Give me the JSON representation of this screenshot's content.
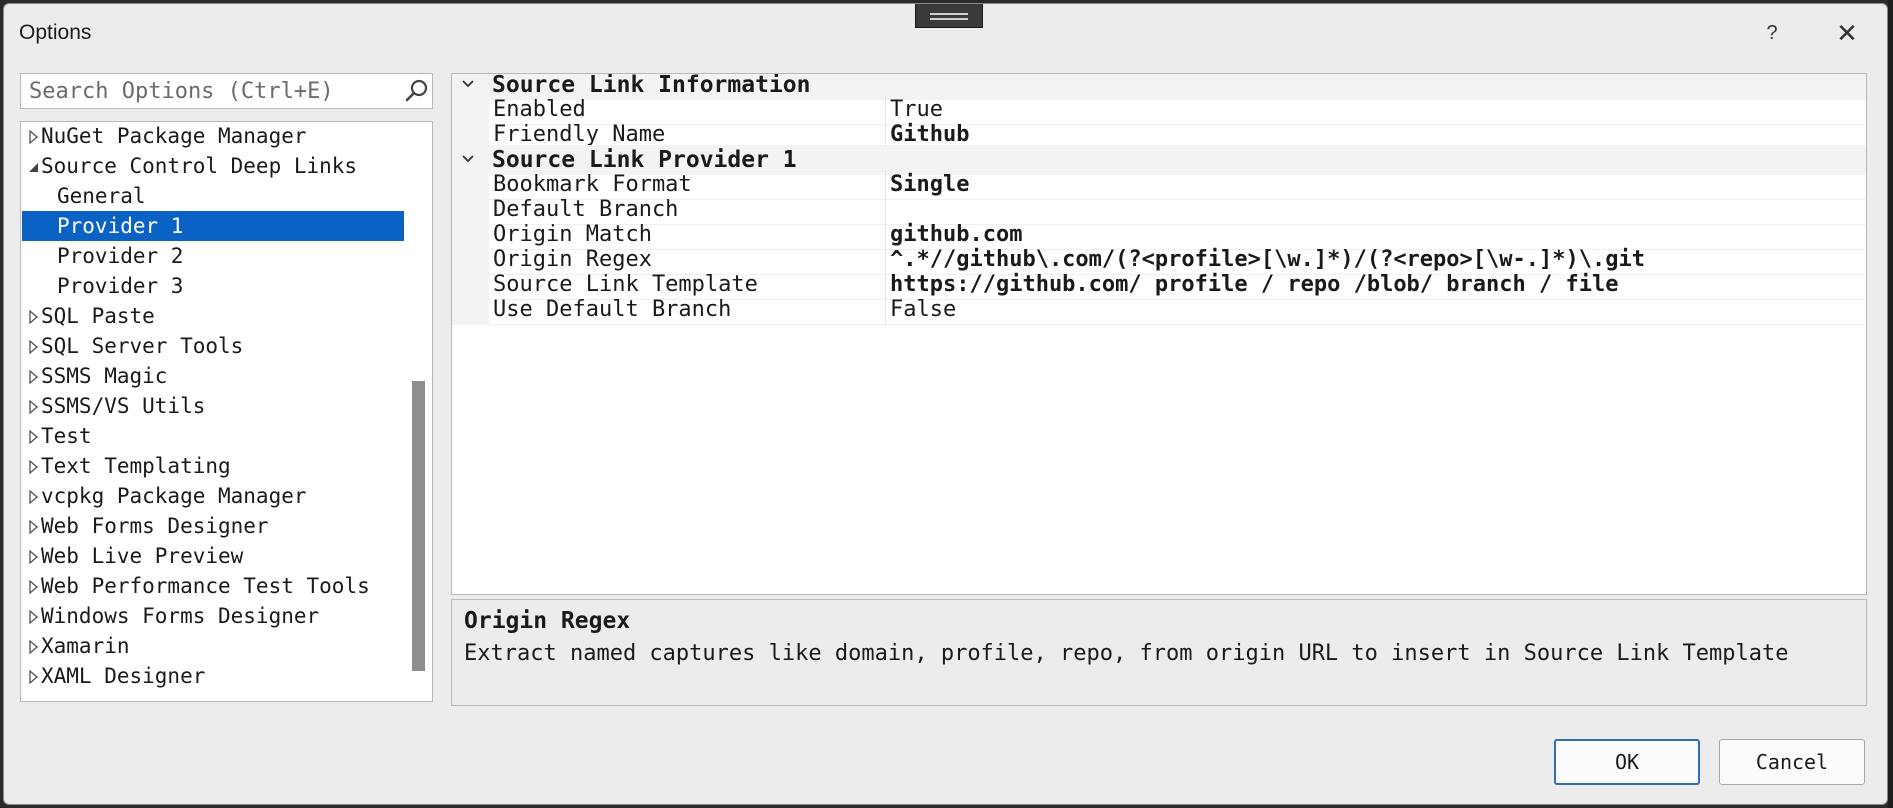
{
  "window": {
    "title": "Options",
    "help_glyph": "?",
    "close_glyph": "✕"
  },
  "search": {
    "placeholder": "Search Options (Ctrl+E)",
    "value": ""
  },
  "tree": {
    "items": [
      {
        "label": "NuGet Package Manager",
        "level": 0,
        "expander": "collapsed",
        "selected": false
      },
      {
        "label": "Source Control Deep Links",
        "level": 0,
        "expander": "expanded",
        "selected": false
      },
      {
        "label": "General",
        "level": 1,
        "expander": "none",
        "selected": false
      },
      {
        "label": "Provider 1",
        "level": 1,
        "expander": "none",
        "selected": true
      },
      {
        "label": "Provider 2",
        "level": 1,
        "expander": "none",
        "selected": false
      },
      {
        "label": "Provider 3",
        "level": 1,
        "expander": "none",
        "selected": false
      },
      {
        "label": "SQL Paste",
        "level": 0,
        "expander": "collapsed",
        "selected": false
      },
      {
        "label": "SQL Server Tools",
        "level": 0,
        "expander": "collapsed",
        "selected": false
      },
      {
        "label": "SSMS Magic",
        "level": 0,
        "expander": "collapsed",
        "selected": false
      },
      {
        "label": "SSMS/VS Utils",
        "level": 0,
        "expander": "collapsed",
        "selected": false
      },
      {
        "label": "Test",
        "level": 0,
        "expander": "collapsed",
        "selected": false
      },
      {
        "label": "Text Templating",
        "level": 0,
        "expander": "collapsed",
        "selected": false
      },
      {
        "label": "vcpkg Package Manager",
        "level": 0,
        "expander": "collapsed",
        "selected": false
      },
      {
        "label": "Web Forms Designer",
        "level": 0,
        "expander": "collapsed",
        "selected": false
      },
      {
        "label": "Web Live Preview",
        "level": 0,
        "expander": "collapsed",
        "selected": false
      },
      {
        "label": "Web Performance Test Tools",
        "level": 0,
        "expander": "collapsed",
        "selected": false
      },
      {
        "label": "Windows Forms Designer",
        "level": 0,
        "expander": "collapsed",
        "selected": false
      },
      {
        "label": "Xamarin",
        "level": 0,
        "expander": "collapsed",
        "selected": false
      },
      {
        "label": "XAML Designer",
        "level": 0,
        "expander": "collapsed",
        "selected": false
      }
    ]
  },
  "property_grid": {
    "categories": [
      {
        "name": "Source Link Information",
        "properties": [
          {
            "name": "Enabled",
            "value": "True",
            "bold": false
          },
          {
            "name": "Friendly Name",
            "value": "Github",
            "bold": true
          }
        ]
      },
      {
        "name": "Source Link Provider 1",
        "properties": [
          {
            "name": "Bookmark Format",
            "value": "Single",
            "bold": true
          },
          {
            "name": "Default Branch",
            "value": "",
            "bold": false
          },
          {
            "name": "Origin Match",
            "value": "github.com",
            "bold": true
          },
          {
            "name": "Origin Regex",
            "value": "^.*//github\\.com/(?<profile>[\\w.]*)/(?<repo>[\\w-.]*)\\.git",
            "bold": true
          },
          {
            "name": "Source Link Template",
            "value": "https://github.com/ profile / repo /blob/ branch / file",
            "bold": true
          },
          {
            "name": "Use Default Branch",
            "value": "False",
            "bold": false
          }
        ]
      }
    ]
  },
  "description": {
    "title": "Origin Regex",
    "text": "Extract named captures like domain, profile, repo, from origin URL to insert in Source Link Template"
  },
  "buttons": {
    "ok": "OK",
    "cancel": "Cancel"
  },
  "colors": {
    "selection": "#0a63c4",
    "dialog_bg": "#ececec",
    "ok_border": "#2f6fb6"
  }
}
